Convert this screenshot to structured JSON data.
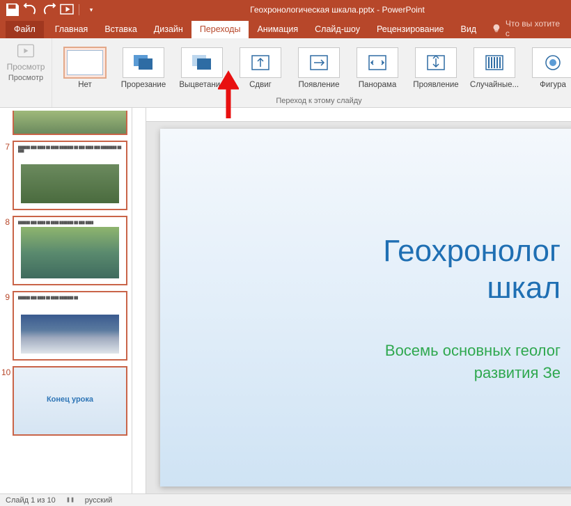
{
  "app": {
    "title": "Геохронологическая шкала.pptx - PowerPoint"
  },
  "tabs": {
    "file": "Файл",
    "home": "Главная",
    "insert": "Вставка",
    "design": "Дизайн",
    "transitions": "Переходы",
    "animations": "Анимация",
    "slideshow": "Слайд-шоу",
    "review": "Рецензирование",
    "view": "Вид",
    "tell": "Что вы хотите с"
  },
  "ribbon": {
    "preview_group": "Просмотр",
    "preview_btn": "Просмотр",
    "transitions_group": "Переход к этому слайду",
    "items": [
      {
        "label": "Нет"
      },
      {
        "label": "Прорезание"
      },
      {
        "label": "Выцветание"
      },
      {
        "label": "Сдвиг"
      },
      {
        "label": "Появление"
      },
      {
        "label": "Панорама"
      },
      {
        "label": "Проявление"
      },
      {
        "label": "Случайные..."
      },
      {
        "label": "Фигура"
      }
    ]
  },
  "slides": {
    "n7": "7",
    "n8": "8",
    "n9": "9",
    "n10": "10",
    "end_title": "Конец урока"
  },
  "main_slide": {
    "title_l1": "Геохронолог",
    "title_l2": "шкал",
    "subtitle_l1": "Восемь основных геолог",
    "subtitle_l2": "развития Зе"
  },
  "status": {
    "slide": "Слайд 1 из 10",
    "lang": "русский"
  }
}
